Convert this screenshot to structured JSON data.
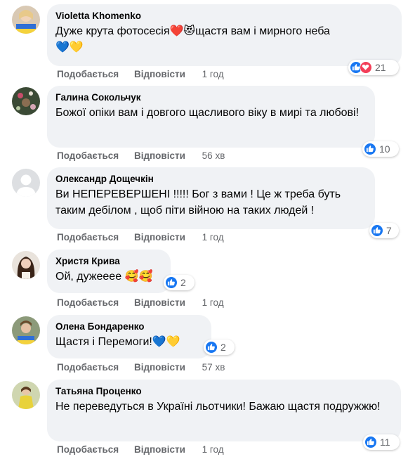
{
  "actions": {
    "like": "Подобається",
    "reply": "Відповісти"
  },
  "comments": [
    {
      "author": "Violetta Khomenko",
      "text": "Дуже крута фотосесія❤️😻щастя вам і мирного неба",
      "text2": "💙💛",
      "time": "1 год",
      "reaction_count": "21",
      "reactions": [
        "like",
        "love"
      ]
    },
    {
      "author": "Галина Сокольчук",
      "text": "Божої опіки вам і довгого щасливого віку в мирі та любові!",
      "time": "56 хв",
      "reaction_count": "10",
      "reactions": [
        "like"
      ]
    },
    {
      "author": "Олександр Дощечкін",
      "text": "Ви НЕПЕРЕВЕРШЕНІ !!!!! Бог з вами ! Це ж треба буть таким дебілом , щоб піти війною на таких людей !",
      "time": "1 год",
      "reaction_count": "7",
      "reactions": [
        "like"
      ]
    },
    {
      "author": "Христя Крива",
      "text": "Ой, дужееее 🥰🥰",
      "time": "1 год",
      "reaction_count": "2",
      "reactions": [
        "like"
      ]
    },
    {
      "author": "Олена Бондаренко",
      "text": "Щастя і Перемоги!💙💛",
      "time": "57 хв",
      "reaction_count": "2",
      "reactions": [
        "like"
      ]
    },
    {
      "author": "Татьяна Проценко",
      "text": "Не переведуться в Україні льотчики! Бажаю щастя подружжю!",
      "time": "1 год",
      "reaction_count": "11",
      "reactions": [
        "like"
      ]
    }
  ]
}
